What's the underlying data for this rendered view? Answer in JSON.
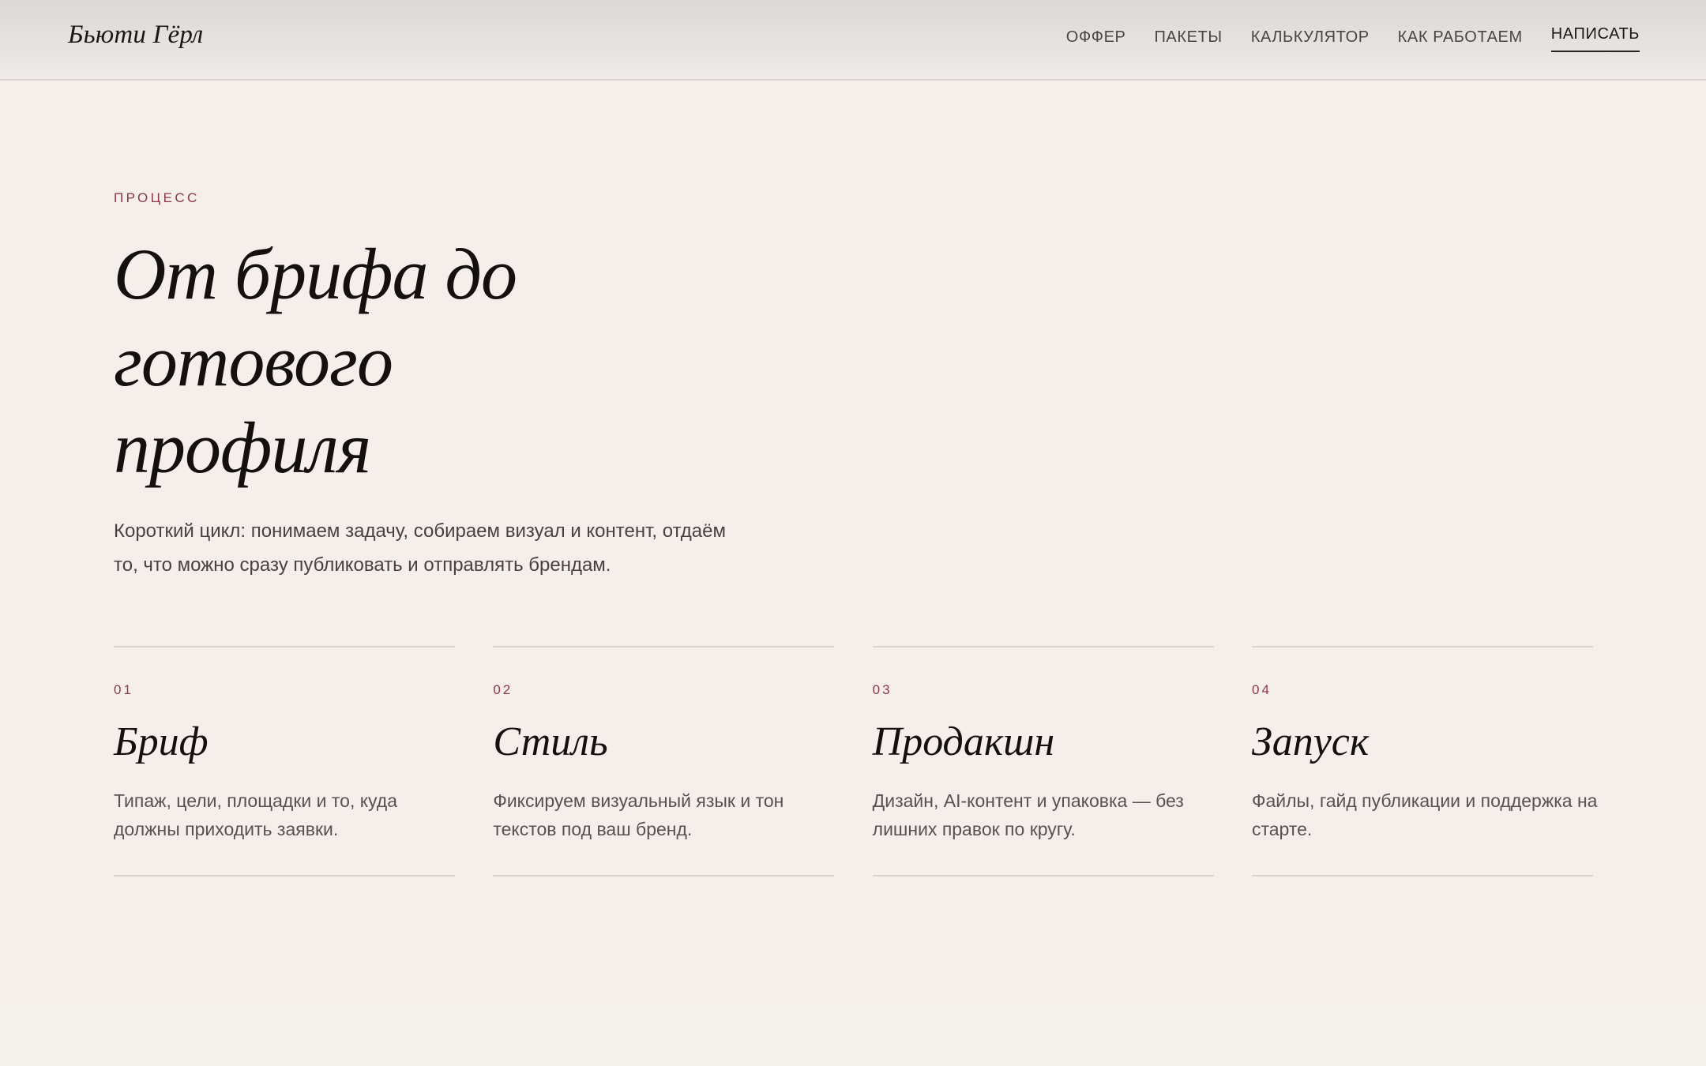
{
  "header": {
    "logo": "Бьюти Гёрл",
    "nav": [
      {
        "label": "ОФФЕР"
      },
      {
        "label": "ПАКЕТЫ"
      },
      {
        "label": "КАЛЬКУЛЯТОР"
      },
      {
        "label": "КАК РАБОТАЕМ"
      },
      {
        "label": "НАПИСАТЬ"
      }
    ]
  },
  "process": {
    "eyebrow": "ПРОЦЕСС",
    "title_lines": [
      "От брифа до",
      "готового",
      "профиля"
    ],
    "lead_lines": [
      "Короткий цикл: понимаем задачу, собираем визуал и контент, отдаём",
      "то, что можно сразу публиковать и отправлять брендам."
    ],
    "steps": [
      {
        "num": "01",
        "title": "Бриф",
        "text": "Типаж, цели, площадки и то, куда должны приходить заявки."
      },
      {
        "num": "02",
        "title": "Стиль",
        "text": "Фиксируем визуальный язык и тон текстов под ваш бренд."
      },
      {
        "num": "03",
        "title": "Продакшн",
        "text": "Дизайн, AI-контент и упаковка — без лишних правок по кругу."
      },
      {
        "num": "04",
        "title": "Запуск",
        "text": "Файлы, гайд публикации и поддержка на старте."
      }
    ]
  },
  "colors": {
    "background": "#f5eeea",
    "accent": "#8a3a42",
    "heading": "#151010",
    "body_text": "#4a4040"
  }
}
